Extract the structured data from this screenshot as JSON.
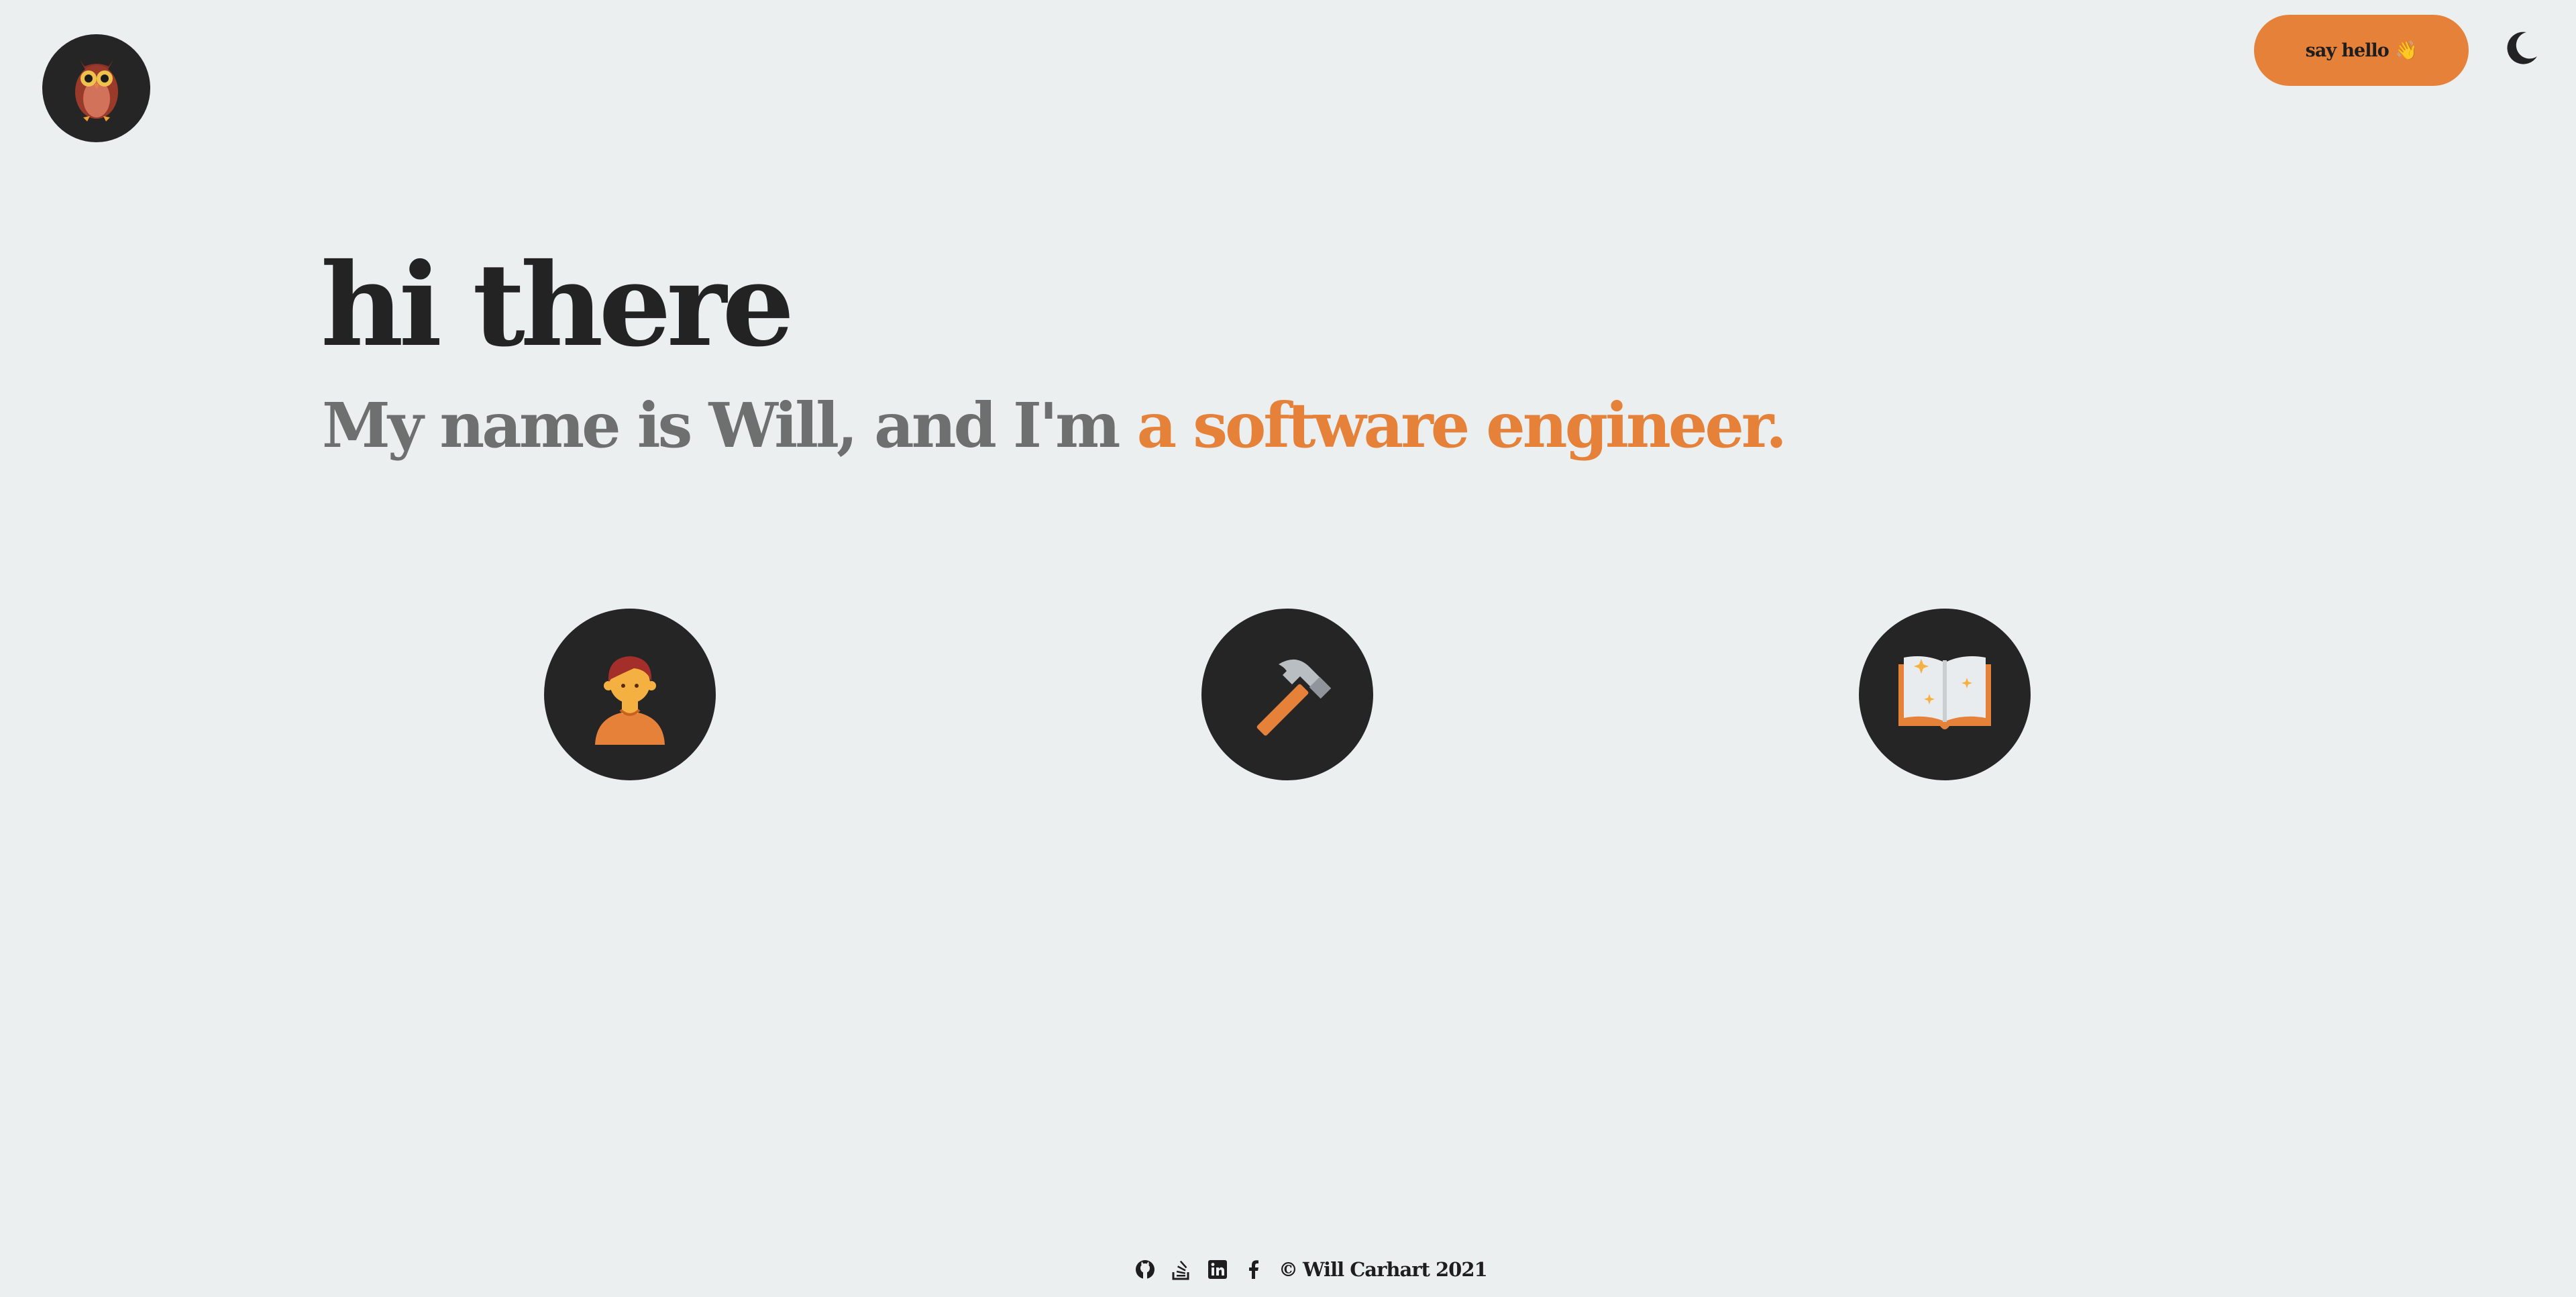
{
  "header": {
    "logo_icon": "owl-icon",
    "say_hello_label": "say hello",
    "say_hello_emoji": "👋",
    "theme_toggle_icon": "moon-icon"
  },
  "hero": {
    "title": "hi there",
    "subtitle_prefix": "My name is Will, and I'm ",
    "subtitle_highlight": "a software engineer."
  },
  "features": [
    {
      "icon": "person-icon"
    },
    {
      "icon": "hammer-icon"
    },
    {
      "icon": "open-book-icon"
    }
  ],
  "footer": {
    "social_icons": [
      "github-icon",
      "stack-overflow-icon",
      "linkedin-icon",
      "facebook-icon"
    ],
    "copyright_symbol": "©",
    "copyright_text": "Will Carhart 2021"
  },
  "colors": {
    "background": "#ebeff0",
    "accent": "#e6813a",
    "circle": "#262526",
    "text_dark": "#232323",
    "text_muted": "#6e7070"
  }
}
